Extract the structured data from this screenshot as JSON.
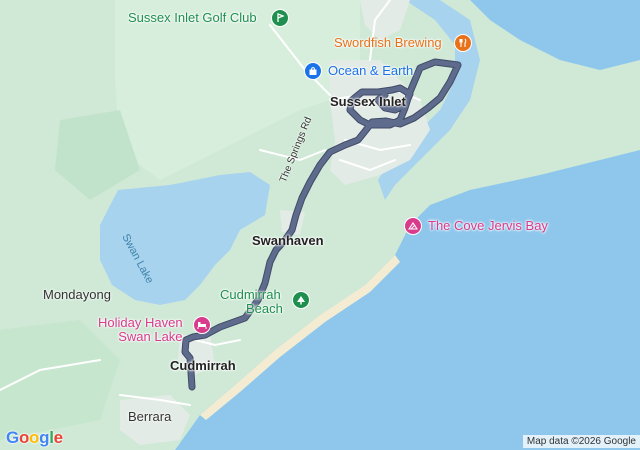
{
  "map": {
    "labels": {
      "sussex_inlet_golf_club": "Sussex Inlet Golf Club",
      "swordfish_brewing": "Swordfish Brewing",
      "ocean_earth": "Ocean & Earth",
      "sussex_inlet": "Sussex Inlet",
      "the_springs_rd": "The Springs Rd",
      "the_cove_jervis_bay": "The Cove Jervis Bay",
      "swan_lake": "Swan Lake",
      "swanhaven": "Swanhaven",
      "mondayong": "Mondayong",
      "cudmirrah_beach_line1": "Cudmirrah",
      "cudmirrah_beach_line2": "Beach",
      "holiday_haven_line1": "Holiday Haven",
      "holiday_haven_line2": "Swan Lake",
      "cudmirrah": "Cudmirrah",
      "berrara": "Berrara"
    },
    "icons": {
      "golf": "golf-icon",
      "restaurant": "fork-knife-icon",
      "shopping": "shopping-bag-icon",
      "park": "park-icon",
      "attraction": "attraction-icon",
      "hotel": "bed-icon"
    },
    "colors": {
      "land": "#cfe9d6",
      "forest": "#bfe3c7",
      "water": "#a8d3ef",
      "ocean": "#8fc7ec",
      "sand": "#f3ecd2",
      "urban": "#e6ebe8",
      "route": "#5f6b8c",
      "route_outline": "#3f4a66",
      "poi_green": "#1e8f4e",
      "poi_orange": "#e8711a",
      "poi_blue": "#1a73e8",
      "poi_pink": "#d93b8c"
    },
    "logo": {
      "g1": "G",
      "o1": "o",
      "o2": "o",
      "g2": "g",
      "l": "l",
      "e": "e"
    },
    "attribution": "Map data ©2026 Google"
  }
}
